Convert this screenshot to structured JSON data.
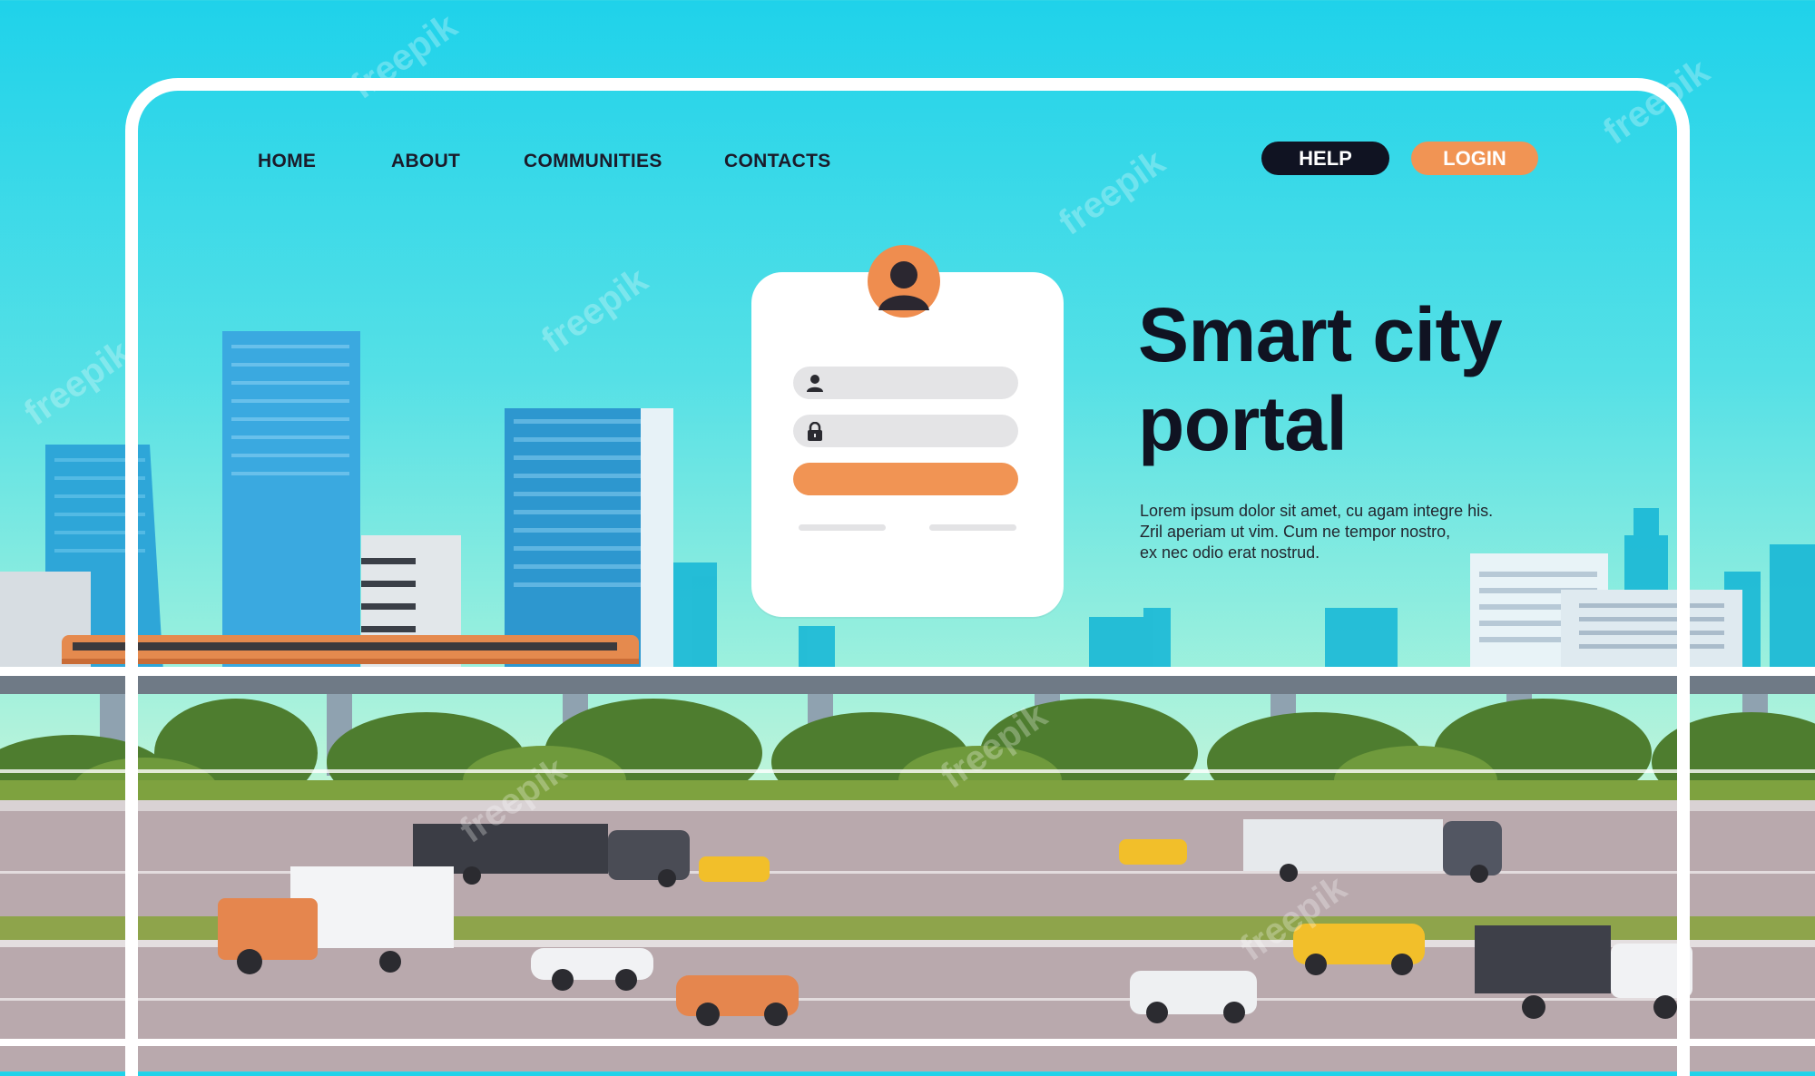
{
  "nav": {
    "links": [
      {
        "label": "HOME"
      },
      {
        "label": "ABOUT"
      },
      {
        "label": "COMMUNITIES"
      },
      {
        "label": "CONTACTS"
      }
    ],
    "help_label": "HELP",
    "login_label": "LOGIN"
  },
  "hero": {
    "title_line1": "Smart city",
    "title_line2": "portal",
    "body_line1": "Lorem ipsum dolor sit amet, cu agam integre his.",
    "body_line2": "Zril aperiam ut vim. Cum ne tempor nostro,",
    "body_line3": "ex nec odio erat nostrud."
  },
  "login_form": {
    "username_icon": "user-icon",
    "password_icon": "lock-icon",
    "avatar_icon": "user-avatar-icon"
  },
  "watermark": "freepik",
  "colors": {
    "sky_top": "#1fd2ea",
    "accent_orange": "#f19454",
    "help_button": "#101322",
    "title_text": "#101322",
    "train": "#e58a4e"
  }
}
